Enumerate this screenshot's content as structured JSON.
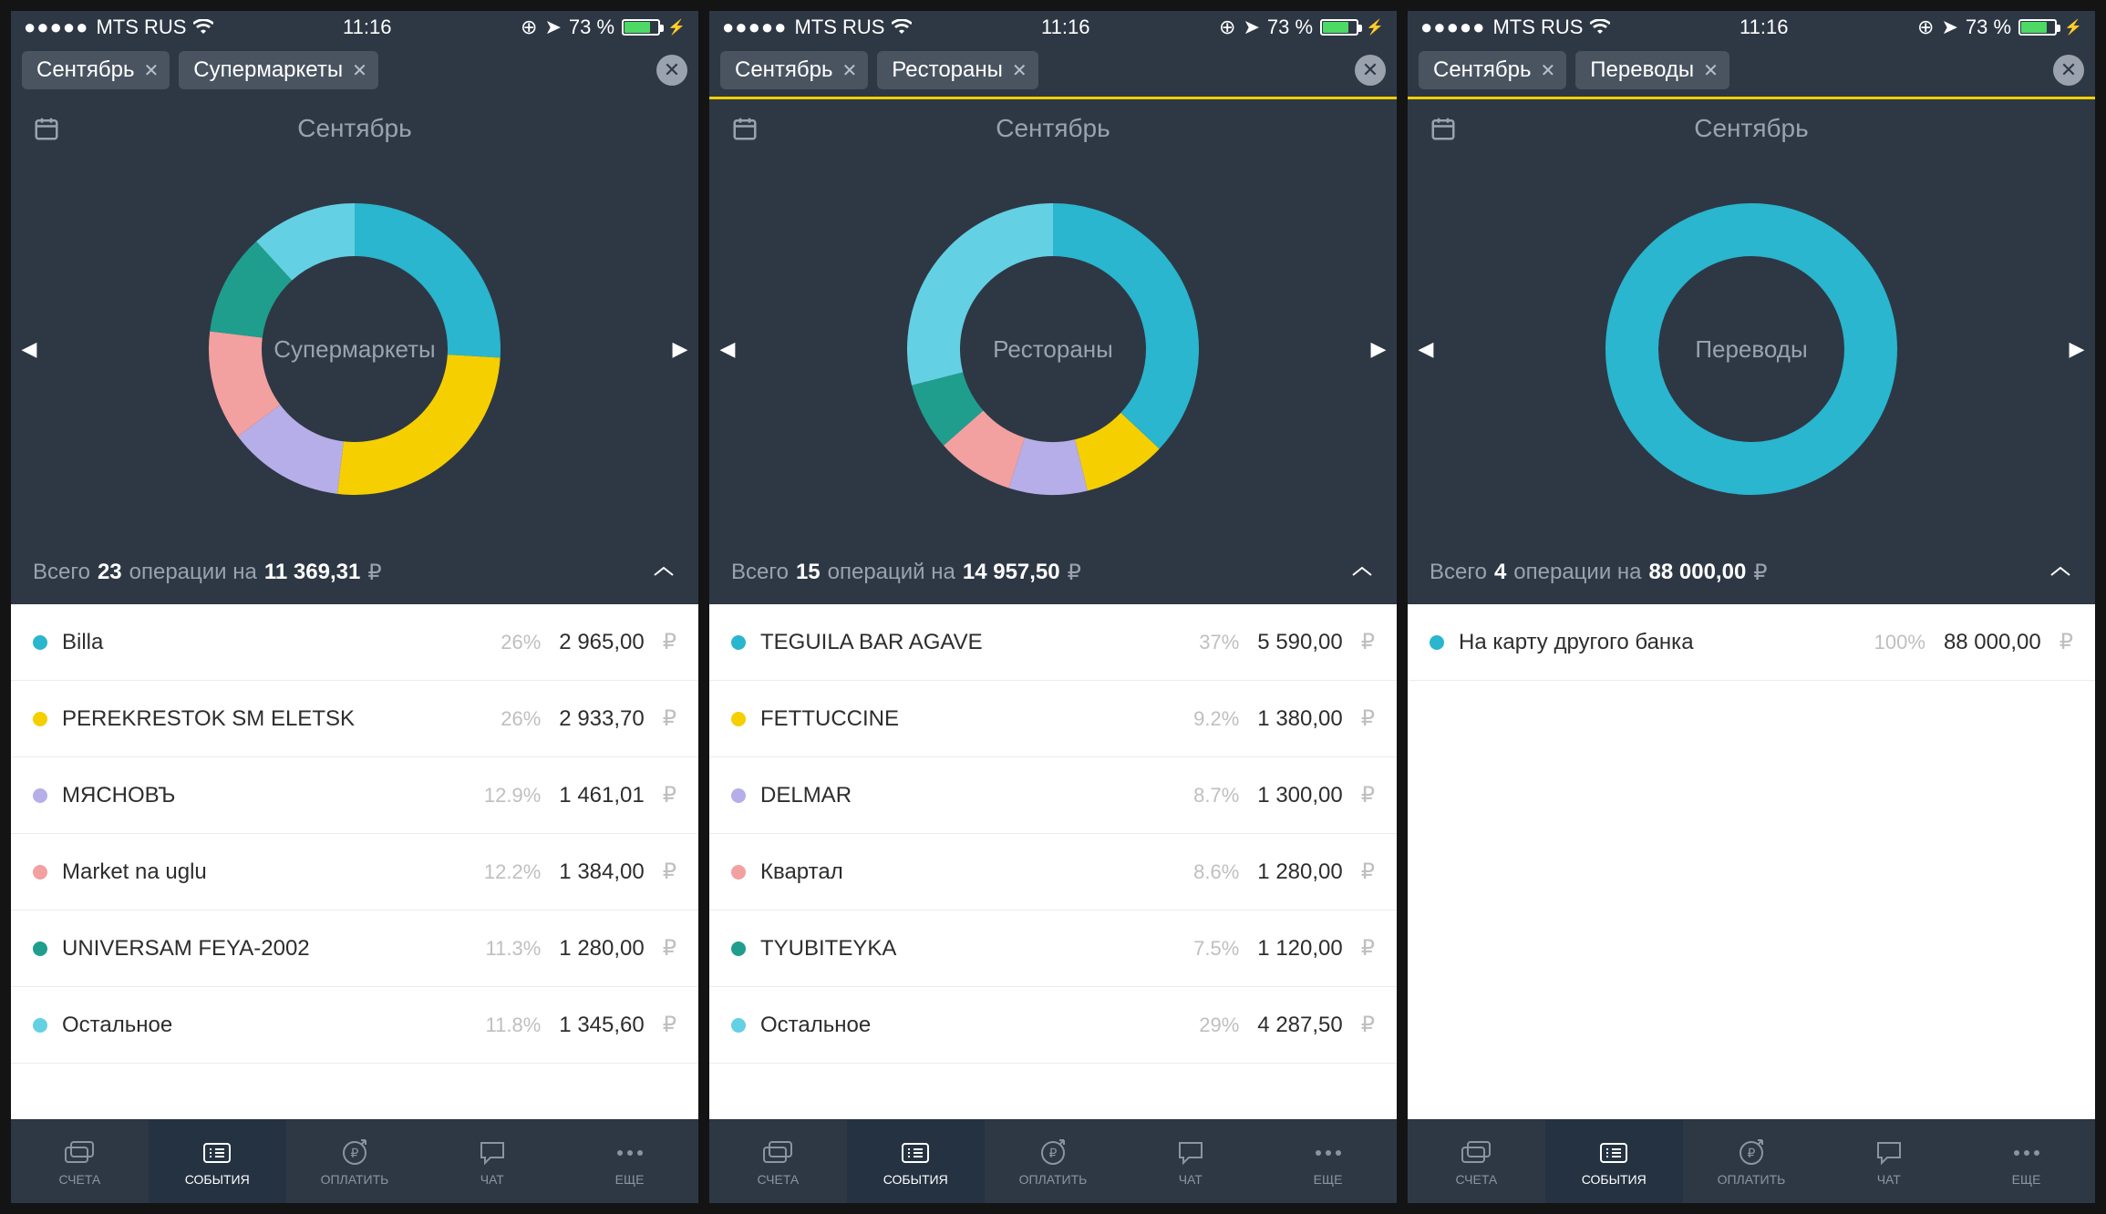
{
  "status": {
    "carrier": "MTS RUS",
    "time": "11:16",
    "battery_pct": "73 %",
    "location_icon": "location",
    "alarm_icon": "alarm"
  },
  "palette": {
    "cyan": "#29b6ce",
    "teal": "#1f9e8e",
    "pink": "#f3a0a0",
    "violet": "#b6aee8",
    "yellow": "#f5cf00",
    "lightcyan": "#64d0e4"
  },
  "tabs": [
    "СЧЕТА",
    "СОБЫТИЯ",
    "ОПЛАТИТЬ",
    "ЧАТ",
    "ЕЩЕ"
  ],
  "active_tab": 1,
  "screens": [
    {
      "chips": [
        "Сентябрь",
        "Супермаркеты"
      ],
      "topline_visible": false,
      "month": "Сентябрь",
      "donut_label": "Супермаркеты",
      "summary": {
        "prefix": "Всего",
        "count": "23",
        "middle": "операции на",
        "amount": "11 369,31",
        "currency": "₽"
      },
      "items": [
        {
          "color": "#29b6ce",
          "name": "Billa",
          "pct": "26%",
          "amount": "2 965,00"
        },
        {
          "color": "#f5cf00",
          "name": "PEREKRESTOK SM ELETSK",
          "pct": "26%",
          "amount": "2 933,70"
        },
        {
          "color": "#b6aee8",
          "name": "МЯСНОВЪ",
          "pct": "12.9%",
          "amount": "1 461,01"
        },
        {
          "color": "#f3a0a0",
          "name": "Market na uglu",
          "pct": "12.2%",
          "amount": "1 384,00"
        },
        {
          "color": "#1f9e8e",
          "name": "UNIVERSAM FEYA-2002",
          "pct": "11.3%",
          "amount": "1 280,00"
        },
        {
          "color": "#64d0e4",
          "name": "Остальное",
          "pct": "11.8%",
          "amount": "1 345,60"
        }
      ]
    },
    {
      "chips": [
        "Сентябрь",
        "Рестораны"
      ],
      "topline_visible": true,
      "month": "Сентябрь",
      "donut_label": "Рестораны",
      "summary": {
        "prefix": "Всего",
        "count": "15",
        "middle": "операций на",
        "amount": "14 957,50",
        "currency": "₽"
      },
      "items": [
        {
          "color": "#29b6ce",
          "name": "TEGUILA BAR AGAVE",
          "pct": "37%",
          "amount": "5 590,00"
        },
        {
          "color": "#f5cf00",
          "name": "FETTUCCINE",
          "pct": "9.2%",
          "amount": "1 380,00"
        },
        {
          "color": "#b6aee8",
          "name": "DELMAR",
          "pct": "8.7%",
          "amount": "1 300,00"
        },
        {
          "color": "#f3a0a0",
          "name": "Квартал",
          "pct": "8.6%",
          "amount": "1 280,00"
        },
        {
          "color": "#1f9e8e",
          "name": "TYUBITEYKA",
          "pct": "7.5%",
          "amount": "1 120,00"
        },
        {
          "color": "#64d0e4",
          "name": "Остальное",
          "pct": "29%",
          "amount": "4 287,50"
        }
      ]
    },
    {
      "chips": [
        "Сентябрь",
        "Переводы"
      ],
      "topline_visible": true,
      "month": "Сентябрь",
      "donut_label": "Переводы",
      "summary": {
        "prefix": "Всего",
        "count": "4",
        "middle": "операции на",
        "amount": "88 000,00",
        "currency": "₽"
      },
      "items": [
        {
          "color": "#29b6ce",
          "name": "На карту другого банка",
          "pct": "100%",
          "amount": "88 000,00"
        }
      ]
    }
  ],
  "chart_data": [
    {
      "type": "pie",
      "title": "Супермаркеты",
      "series": [
        {
          "name": "Сентябрь",
          "values": [
            26,
            26,
            12.9,
            12.2,
            11.3,
            11.8
          ]
        }
      ],
      "categories": [
        "Billa",
        "PEREKRESTOK SM ELETSK",
        "МЯСНОВЪ",
        "Market na uglu",
        "UNIVERSAM FEYA-2002",
        "Остальное"
      ],
      "colors": [
        "#29b6ce",
        "#f5cf00",
        "#b6aee8",
        "#f3a0a0",
        "#1f9e8e",
        "#64d0e4"
      ]
    },
    {
      "type": "pie",
      "title": "Рестораны",
      "series": [
        {
          "name": "Сентябрь",
          "values": [
            37,
            9.2,
            8.7,
            8.6,
            7.5,
            29
          ]
        }
      ],
      "categories": [
        "TEGUILA BAR AGAVE",
        "FETTUCCINE",
        "DELMAR",
        "Квартал",
        "TYUBITEYKA",
        "Остальное"
      ],
      "colors": [
        "#29b6ce",
        "#f5cf00",
        "#b6aee8",
        "#f3a0a0",
        "#1f9e8e",
        "#64d0e4"
      ]
    },
    {
      "type": "pie",
      "title": "Переводы",
      "series": [
        {
          "name": "Сентябрь",
          "values": [
            100
          ]
        }
      ],
      "categories": [
        "На карту другого банка"
      ],
      "colors": [
        "#29b6ce"
      ]
    }
  ]
}
